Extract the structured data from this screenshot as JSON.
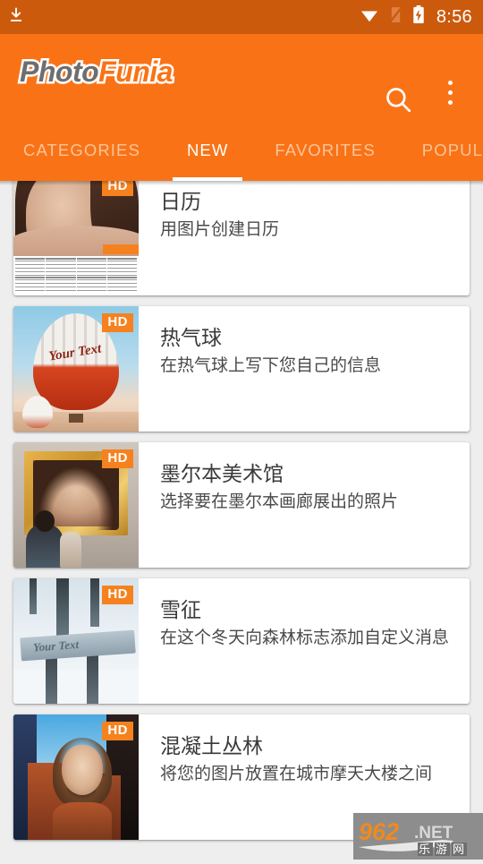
{
  "status_bar": {
    "download_icon": "download-icon",
    "wifi_icon": "wifi-icon",
    "signal_off_icon": "signal-no-sim-icon",
    "battery_icon": "battery-charging-icon",
    "time": "8:56",
    "background_color": "#cc5a0d"
  },
  "app_bar": {
    "logo_part1": "Photo",
    "logo_part2": "Funia",
    "logo_color1": "#6e6e6e",
    "logo_color2": "#f97316",
    "search_icon": "search-icon",
    "overflow_icon": "more-vertical-icon",
    "background_color": "#f97316"
  },
  "tabs": {
    "active_index": 1,
    "items": [
      {
        "label": "CATEGORIES"
      },
      {
        "label": "NEW"
      },
      {
        "label": "FAVORITES"
      },
      {
        "label": "POPULAR"
      }
    ]
  },
  "list": {
    "items": [
      {
        "title": "日历",
        "subtitle": "用图片创建日历",
        "badge": "HD",
        "thumb": "calendar-portrait-thumbnail"
      },
      {
        "title": "热气球",
        "subtitle": "在热气球上写下您自己的信息",
        "badge": "HD",
        "thumb": "hot-air-balloon-thumbnail",
        "thumb_text": "Your Text"
      },
      {
        "title": "墨尔本美术馆",
        "subtitle": "选择要在墨尔本画廊展出的照片",
        "badge": "HD",
        "thumb": "art-gallery-frame-thumbnail"
      },
      {
        "title": "雪征",
        "subtitle": "在这个冬天向森林标志添加自定义消息",
        "badge": "HD",
        "thumb": "snow-forest-sign-thumbnail",
        "thumb_text": "Your Text"
      },
      {
        "title": "混凝土丛林",
        "subtitle": "将您的图片放置在城市摩天大楼之间",
        "badge": "HD",
        "thumb": "concrete-jungle-thumbnail"
      }
    ]
  },
  "watermark": {
    "number": "962",
    "suffix": ".NET",
    "chinese": "乐游网",
    "number_color": "#f08a1e"
  }
}
